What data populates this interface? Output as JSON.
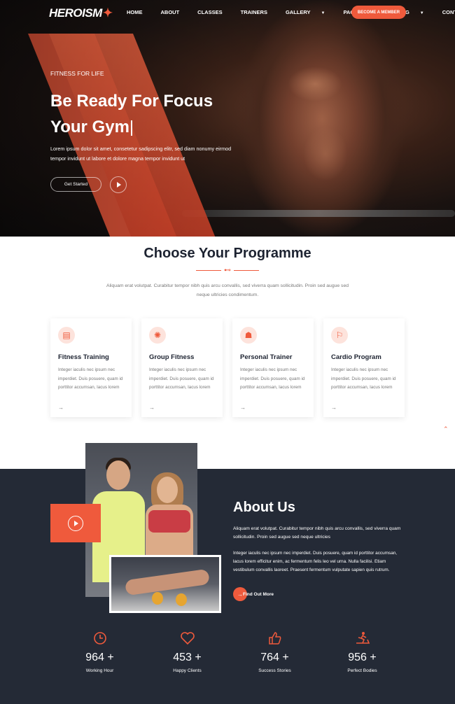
{
  "header": {
    "logo": "HEROISM",
    "menu": [
      {
        "label": "HOME",
        "dropdown": false
      },
      {
        "label": "ABOUT",
        "dropdown": false
      },
      {
        "label": "CLASSES",
        "dropdown": false
      },
      {
        "label": "TRAINERS",
        "dropdown": false
      },
      {
        "label": "GALLERY",
        "dropdown": true
      },
      {
        "label": "PAGES",
        "dropdown": true
      },
      {
        "label": "BLOG",
        "dropdown": true
      },
      {
        "label": "CONTACT",
        "dropdown": false
      }
    ],
    "cta": "BECOME A MEMBER"
  },
  "hero": {
    "tagline": "FITNESS FOR LIFE",
    "title_line1": "Be Ready For Focus",
    "title_line2": "Your Gym",
    "description": "Lorem ipsum dolor sit amet, consetetur sadipscing elitr, sed diam nonumy eirmod tempor invidunt ut labore et dolore magna tempor invidunt ut",
    "button": "Get Started"
  },
  "programme": {
    "title": "Choose Your Programme",
    "subtitle": "Aliquam erat volutpat. Curabitur tempor nibh quis arcu convallis, sed viverra quam sollicitudin. Proin sed augue sed neque ultricies condimentum.",
    "cards": [
      {
        "icon": "clipboard-icon",
        "title": "Fitness Training",
        "text": "Integer iaculis nec ipsum nec imperdiet. Duis posuere, quam id porttitor accumsan, lacus lorem"
      },
      {
        "icon": "group-fitness-icon",
        "title": "Group Fitness",
        "text": "Integer iaculis nec ipsum nec imperdiet. Duis posuere, quam id porttitor accumsan, lacus lorem"
      },
      {
        "icon": "weightlifter-icon",
        "title": "Personal Trainer",
        "text": "Integer iaculis nec ipsum nec imperdiet. Duis posuere, quam id porttitor accumsan, lacus lorem"
      },
      {
        "icon": "treadmill-icon",
        "title": "Cardio Program",
        "text": "Integer iaculis nec ipsum nec imperdiet. Duis posuere, quam id porttitor accumsan, lacus lorem"
      }
    ]
  },
  "about": {
    "title": "About Us",
    "paragraph1": "Aliquam erat volutpat. Curabitur tempor nibh quis arcu convallis, sed viverra quam sollicitudin. Proin sed augue sed neque ultricies",
    "paragraph2": "Integer iaculis nec ipsum nec imperdiet. Duis posuere, quam id porttitor accumsan, lacus lorem efficitur enim, ac fermentum felis leo vel urna. Nulla facilisi. Etiam vestibulum convallis laoreet. Praesent fermentum vulputate sapien quis rutrum.",
    "button": "Find Out More"
  },
  "stats": [
    {
      "icon": "clock-icon",
      "value": "964 +",
      "label": "Working Hour"
    },
    {
      "icon": "heart-icon",
      "value": "453 +",
      "label": "Happy Clients"
    },
    {
      "icon": "thumbs-up-icon",
      "value": "764 +",
      "label": "Success Stories"
    },
    {
      "icon": "treadmill-runner-icon",
      "value": "956 +",
      "label": "Perfect Bodies"
    }
  ],
  "colors": {
    "accent": "#ef5a3c",
    "dark": "#242a36",
    "heading": "#1d2331"
  }
}
